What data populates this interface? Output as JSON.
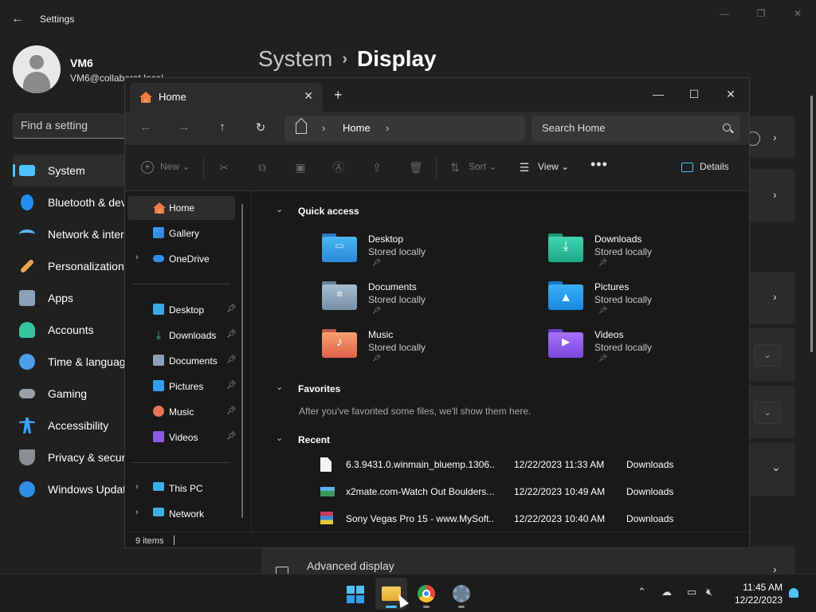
{
  "settings": {
    "title": "Settings",
    "user_name": "VM6",
    "user_email": "VM6@collaborat.local",
    "search_placeholder": "Find a setting",
    "breadcrumb_parent": "System",
    "breadcrumb_current": "Display",
    "nav": [
      {
        "label": "System",
        "icon": "system-icon",
        "color": "#4cc2ff"
      },
      {
        "label": "Bluetooth & devices",
        "icon": "bluetooth-icon",
        "color": "#1f8ff0"
      },
      {
        "label": "Network & internet",
        "icon": "wifi-icon",
        "color": "#5ab6f5"
      },
      {
        "label": "Personalization",
        "icon": "brush-icon",
        "color": "#e8a64a"
      },
      {
        "label": "Apps",
        "icon": "apps-icon",
        "color": "#8aa1b8"
      },
      {
        "label": "Accounts",
        "icon": "accounts-icon",
        "color": "#37c4a0"
      },
      {
        "label": "Time & language",
        "icon": "clock-globe-icon",
        "color": "#4a9fe8"
      },
      {
        "label": "Gaming",
        "icon": "gamepad-icon",
        "color": "#9aa0a8"
      },
      {
        "label": "Accessibility",
        "icon": "accessibility-icon",
        "color": "#3aa0ff"
      },
      {
        "label": "Privacy & security",
        "icon": "shield-icon",
        "color": "#8a8f96"
      },
      {
        "label": "Windows Update",
        "icon": "update-icon",
        "color": "#2f8fe8"
      }
    ],
    "advanced_display": "Advanced display"
  },
  "explorer": {
    "tab_label": "Home",
    "address_current": "Home",
    "search_placeholder": "Search Home",
    "commands": {
      "new": "New",
      "sort": "Sort",
      "view": "View",
      "details": "Details"
    },
    "sidebar": {
      "top": [
        {
          "label": "Home",
          "icon": "home-icon"
        },
        {
          "label": "Gallery",
          "icon": "gallery-icon"
        },
        {
          "label": "OneDrive",
          "icon": "onedrive-icon"
        }
      ],
      "pinned": [
        {
          "label": "Desktop",
          "icon": "desktop-folder-icon"
        },
        {
          "label": "Downloads",
          "icon": "downloads-folder-icon"
        },
        {
          "label": "Documents",
          "icon": "documents-folder-icon"
        },
        {
          "label": "Pictures",
          "icon": "pictures-folder-icon"
        },
        {
          "label": "Music",
          "icon": "music-folder-icon"
        },
        {
          "label": "Videos",
          "icon": "videos-folder-icon"
        }
      ],
      "bottom": [
        {
          "label": "This PC",
          "icon": "this-pc-icon"
        },
        {
          "label": "Network",
          "icon": "network-icon"
        }
      ]
    },
    "quick_access_title": "Quick access",
    "quick_access": [
      {
        "name": "Desktop",
        "sub": "Stored locally",
        "icon": "desktop-folder-icon"
      },
      {
        "name": "Downloads",
        "sub": "Stored locally",
        "icon": "downloads-folder-icon"
      },
      {
        "name": "Documents",
        "sub": "Stored locally",
        "icon": "documents-folder-icon"
      },
      {
        "name": "Pictures",
        "sub": "Stored locally",
        "icon": "pictures-folder-icon"
      },
      {
        "name": "Music",
        "sub": "Stored locally",
        "icon": "music-folder-icon"
      },
      {
        "name": "Videos",
        "sub": "Stored locally",
        "icon": "videos-folder-icon"
      }
    ],
    "favorites_title": "Favorites",
    "favorites_empty": "After you've favorited some files, we'll show them here.",
    "recent_title": "Recent",
    "recent": [
      {
        "name": "6.3.9431.0.winmain_bluemp.1306...",
        "date": "12/22/2023 11:33 AM",
        "location": "Downloads",
        "icon": "file-icon"
      },
      {
        "name": "x2mate.com-Watch Out Boulders...",
        "date": "12/22/2023 10:49 AM",
        "location": "Downloads",
        "icon": "video-file-icon"
      },
      {
        "name": "Sony Vegas Pro 15 - www.MySoft...",
        "date": "12/22/2023 10:40 AM",
        "location": "Downloads",
        "icon": "archive-file-icon"
      }
    ],
    "status_items": "9 items"
  },
  "taskbar": {
    "time": "11:45 AM",
    "date": "12/22/2023",
    "apps": [
      "start-icon",
      "file-explorer-icon",
      "chrome-icon",
      "settings-gear-icon"
    ]
  }
}
